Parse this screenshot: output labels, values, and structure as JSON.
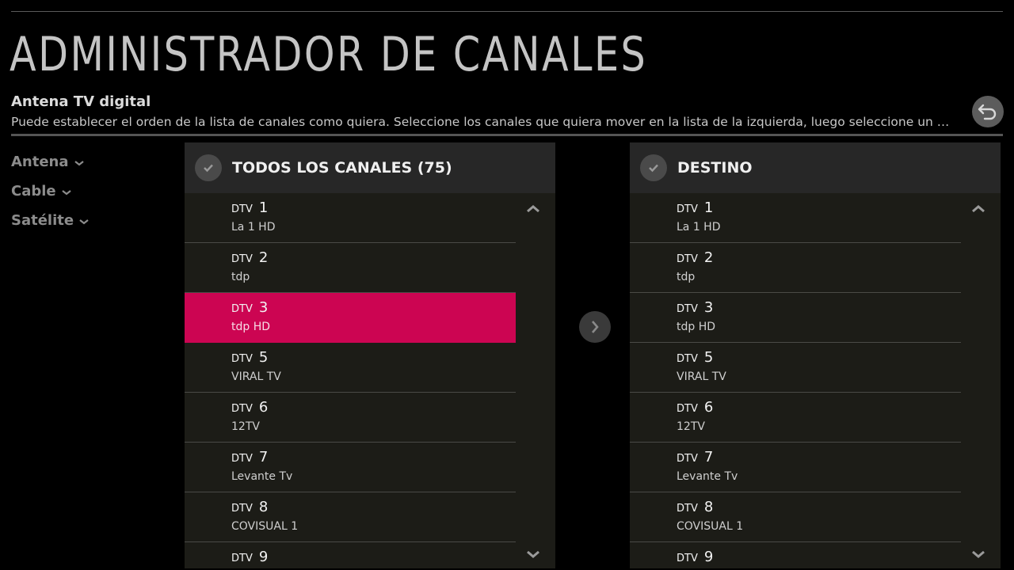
{
  "header": {
    "title": "ADMINISTRADOR DE CANALES",
    "subtitle": "Antena TV digital",
    "description": "Puede establecer el orden de la lista de canales como quiera. Seleccione los canales que quiera mover en la lista de la izquierda, luego seleccione un o..."
  },
  "icons": {
    "back": "back-arrow-icon",
    "check": "checkmark-icon",
    "move": "chevron-right-icon",
    "scroll_up": "chevron-up-icon",
    "scroll_down": "chevron-down-icon"
  },
  "colors": {
    "accent": "#cc0552",
    "background": "#000000",
    "panel": "#1c1c17"
  },
  "sources": [
    {
      "label": "Antena"
    },
    {
      "label": "Cable"
    },
    {
      "label": "Satélite"
    }
  ],
  "left_panel": {
    "title": "TODOS LOS CANALES (75)",
    "channels": [
      {
        "type": "DTV",
        "number": "1",
        "name": "La 1 HD"
      },
      {
        "type": "DTV",
        "number": "2",
        "name": "tdp"
      },
      {
        "type": "DTV",
        "number": "3",
        "name": "tdp HD"
      },
      {
        "type": "DTV",
        "number": "5",
        "name": "VIRAL TV"
      },
      {
        "type": "DTV",
        "number": "6",
        "name": "12TV"
      },
      {
        "type": "DTV",
        "number": "7",
        "name": "Levante Tv"
      },
      {
        "type": "DTV",
        "number": "8",
        "name": "COVISUAL 1"
      },
      {
        "type": "DTV",
        "number": "9",
        "name": ""
      }
    ]
  },
  "right_panel": {
    "title": "DESTINO",
    "channels": [
      {
        "type": "DTV",
        "number": "1",
        "name": "La 1 HD"
      },
      {
        "type": "DTV",
        "number": "2",
        "name": "tdp"
      },
      {
        "type": "DTV",
        "number": "3",
        "name": "tdp HD"
      },
      {
        "type": "DTV",
        "number": "5",
        "name": "VIRAL TV"
      },
      {
        "type": "DTV",
        "number": "6",
        "name": "12TV"
      },
      {
        "type": "DTV",
        "number": "7",
        "name": "Levante Tv"
      },
      {
        "type": "DTV",
        "number": "8",
        "name": "COVISUAL 1"
      },
      {
        "type": "DTV",
        "number": "9",
        "name": ""
      }
    ]
  }
}
